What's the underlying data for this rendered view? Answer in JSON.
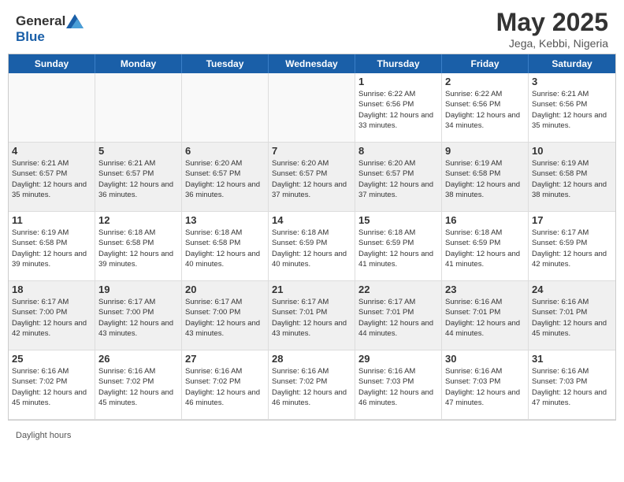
{
  "header": {
    "logo_general": "General",
    "logo_blue": "Blue",
    "title": "May 2025",
    "location": "Jega, Kebbi, Nigeria"
  },
  "days": [
    "Sunday",
    "Monday",
    "Tuesday",
    "Wednesday",
    "Thursday",
    "Friday",
    "Saturday"
  ],
  "weeks": [
    [
      {
        "day": "",
        "empty": true
      },
      {
        "day": "",
        "empty": true
      },
      {
        "day": "",
        "empty": true
      },
      {
        "day": "",
        "empty": true
      },
      {
        "day": "1",
        "sunrise": "Sunrise: 6:22 AM",
        "sunset": "Sunset: 6:56 PM",
        "daylight": "Daylight: 12 hours and 33 minutes."
      },
      {
        "day": "2",
        "sunrise": "Sunrise: 6:22 AM",
        "sunset": "Sunset: 6:56 PM",
        "daylight": "Daylight: 12 hours and 34 minutes."
      },
      {
        "day": "3",
        "sunrise": "Sunrise: 6:21 AM",
        "sunset": "Sunset: 6:56 PM",
        "daylight": "Daylight: 12 hours and 35 minutes."
      }
    ],
    [
      {
        "day": "4",
        "sunrise": "Sunrise: 6:21 AM",
        "sunset": "Sunset: 6:57 PM",
        "daylight": "Daylight: 12 hours and 35 minutes."
      },
      {
        "day": "5",
        "sunrise": "Sunrise: 6:21 AM",
        "sunset": "Sunset: 6:57 PM",
        "daylight": "Daylight: 12 hours and 36 minutes."
      },
      {
        "day": "6",
        "sunrise": "Sunrise: 6:20 AM",
        "sunset": "Sunset: 6:57 PM",
        "daylight": "Daylight: 12 hours and 36 minutes."
      },
      {
        "day": "7",
        "sunrise": "Sunrise: 6:20 AM",
        "sunset": "Sunset: 6:57 PM",
        "daylight": "Daylight: 12 hours and 37 minutes."
      },
      {
        "day": "8",
        "sunrise": "Sunrise: 6:20 AM",
        "sunset": "Sunset: 6:57 PM",
        "daylight": "Daylight: 12 hours and 37 minutes."
      },
      {
        "day": "9",
        "sunrise": "Sunrise: 6:19 AM",
        "sunset": "Sunset: 6:58 PM",
        "daylight": "Daylight: 12 hours and 38 minutes."
      },
      {
        "day": "10",
        "sunrise": "Sunrise: 6:19 AM",
        "sunset": "Sunset: 6:58 PM",
        "daylight": "Daylight: 12 hours and 38 minutes."
      }
    ],
    [
      {
        "day": "11",
        "sunrise": "Sunrise: 6:19 AM",
        "sunset": "Sunset: 6:58 PM",
        "daylight": "Daylight: 12 hours and 39 minutes."
      },
      {
        "day": "12",
        "sunrise": "Sunrise: 6:18 AM",
        "sunset": "Sunset: 6:58 PM",
        "daylight": "Daylight: 12 hours and 39 minutes."
      },
      {
        "day": "13",
        "sunrise": "Sunrise: 6:18 AM",
        "sunset": "Sunset: 6:58 PM",
        "daylight": "Daylight: 12 hours and 40 minutes."
      },
      {
        "day": "14",
        "sunrise": "Sunrise: 6:18 AM",
        "sunset": "Sunset: 6:59 PM",
        "daylight": "Daylight: 12 hours and 40 minutes."
      },
      {
        "day": "15",
        "sunrise": "Sunrise: 6:18 AM",
        "sunset": "Sunset: 6:59 PM",
        "daylight": "Daylight: 12 hours and 41 minutes."
      },
      {
        "day": "16",
        "sunrise": "Sunrise: 6:18 AM",
        "sunset": "Sunset: 6:59 PM",
        "daylight": "Daylight: 12 hours and 41 minutes."
      },
      {
        "day": "17",
        "sunrise": "Sunrise: 6:17 AM",
        "sunset": "Sunset: 6:59 PM",
        "daylight": "Daylight: 12 hours and 42 minutes."
      }
    ],
    [
      {
        "day": "18",
        "sunrise": "Sunrise: 6:17 AM",
        "sunset": "Sunset: 7:00 PM",
        "daylight": "Daylight: 12 hours and 42 minutes."
      },
      {
        "day": "19",
        "sunrise": "Sunrise: 6:17 AM",
        "sunset": "Sunset: 7:00 PM",
        "daylight": "Daylight: 12 hours and 43 minutes."
      },
      {
        "day": "20",
        "sunrise": "Sunrise: 6:17 AM",
        "sunset": "Sunset: 7:00 PM",
        "daylight": "Daylight: 12 hours and 43 minutes."
      },
      {
        "day": "21",
        "sunrise": "Sunrise: 6:17 AM",
        "sunset": "Sunset: 7:01 PM",
        "daylight": "Daylight: 12 hours and 43 minutes."
      },
      {
        "day": "22",
        "sunrise": "Sunrise: 6:17 AM",
        "sunset": "Sunset: 7:01 PM",
        "daylight": "Daylight: 12 hours and 44 minutes."
      },
      {
        "day": "23",
        "sunrise": "Sunrise: 6:16 AM",
        "sunset": "Sunset: 7:01 PM",
        "daylight": "Daylight: 12 hours and 44 minutes."
      },
      {
        "day": "24",
        "sunrise": "Sunrise: 6:16 AM",
        "sunset": "Sunset: 7:01 PM",
        "daylight": "Daylight: 12 hours and 45 minutes."
      }
    ],
    [
      {
        "day": "25",
        "sunrise": "Sunrise: 6:16 AM",
        "sunset": "Sunset: 7:02 PM",
        "daylight": "Daylight: 12 hours and 45 minutes."
      },
      {
        "day": "26",
        "sunrise": "Sunrise: 6:16 AM",
        "sunset": "Sunset: 7:02 PM",
        "daylight": "Daylight: 12 hours and 45 minutes."
      },
      {
        "day": "27",
        "sunrise": "Sunrise: 6:16 AM",
        "sunset": "Sunset: 7:02 PM",
        "daylight": "Daylight: 12 hours and 46 minutes."
      },
      {
        "day": "28",
        "sunrise": "Sunrise: 6:16 AM",
        "sunset": "Sunset: 7:02 PM",
        "daylight": "Daylight: 12 hours and 46 minutes."
      },
      {
        "day": "29",
        "sunrise": "Sunrise: 6:16 AM",
        "sunset": "Sunset: 7:03 PM",
        "daylight": "Daylight: 12 hours and 46 minutes."
      },
      {
        "day": "30",
        "sunrise": "Sunrise: 6:16 AM",
        "sunset": "Sunset: 7:03 PM",
        "daylight": "Daylight: 12 hours and 47 minutes."
      },
      {
        "day": "31",
        "sunrise": "Sunrise: 6:16 AM",
        "sunset": "Sunset: 7:03 PM",
        "daylight": "Daylight: 12 hours and 47 minutes."
      }
    ]
  ],
  "footer": {
    "text": "Daylight hours"
  }
}
